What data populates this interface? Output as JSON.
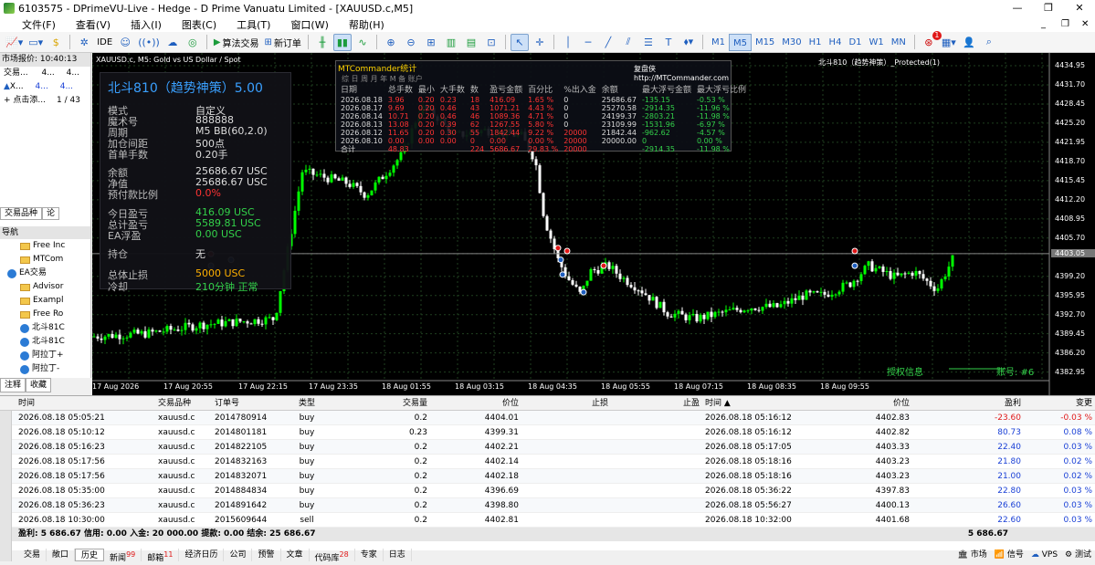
{
  "window": {
    "title": "6103575 - DPrimeVU-Live - Hedge - D Prime Vanuatu Limited - [XAUUSD.c,M5]",
    "minimize": "—",
    "restore": "❐",
    "close": "✕"
  },
  "menu": [
    "文件(F)",
    "查看(V)",
    "插入(I)",
    "图表(C)",
    "工具(T)",
    "窗口(W)",
    "帮助(H)"
  ],
  "toolbar": {
    "algo": "算法交易",
    "neworder": "新订单",
    "ide": "IDE",
    "timeframes": [
      "M1",
      "M5",
      "M15",
      "M30",
      "H1",
      "H4",
      "D1",
      "W1",
      "MN"
    ],
    "active_tf": "M5",
    "badge": "1"
  },
  "market_watch": {
    "header": "市场报价: 10:40:13",
    "col1": "交易...",
    "col2": "4...",
    "col3": "4...",
    "sym": "X...",
    "v1": "4...",
    "v2": "4...",
    "add": "+ 点击添...",
    "count": "1 / 43"
  },
  "mw_tabs": [
    "交易品种",
    "论"
  ],
  "navigator": {
    "header": "导航",
    "items": [
      {
        "t": "Free Inc",
        "k": "folder"
      },
      {
        "t": "MTCom",
        "k": "folder"
      },
      {
        "t": "EA交易",
        "k": "ea"
      },
      {
        "t": "Advisor",
        "k": "folder"
      },
      {
        "t": "Exampl",
        "k": "folder"
      },
      {
        "t": "Free Ro",
        "k": "folder"
      },
      {
        "t": "北斗81C",
        "k": "ea"
      },
      {
        "t": "北斗81C",
        "k": "ea"
      },
      {
        "t": "阿拉丁+",
        "k": "ea"
      },
      {
        "t": "阿拉丁-",
        "k": "ea"
      }
    ]
  },
  "nav_tabs": [
    "注释",
    "收藏"
  ],
  "chart": {
    "symbol_line": "XAUUSD.c, M5:  Gold vs US Dollar / Spot",
    "right_label": "北斗810（趋势神策）_Protected(1)",
    "auth": "授权信息",
    "account": "账号: #6",
    "current_price": "4403.05",
    "prices": [
      "4434.95",
      "4431.70",
      "4428.45",
      "4425.20",
      "4421.95",
      "4418.70",
      "4415.45",
      "4412.20",
      "4408.95",
      "4405.70",
      "4403.05",
      "4399.20",
      "4395.95",
      "4392.70",
      "4389.45",
      "4386.20",
      "4382.95"
    ],
    "times": [
      "17 Aug 2026",
      "17 Aug 20:55",
      "17 Aug 22:15",
      "17 Aug 23:35",
      "18 Aug 01:55",
      "18 Aug 03:15",
      "18 Aug 04:35",
      "18 Aug 05:55",
      "18 Aug 07:15",
      "18 Aug 08:35",
      "18 Aug 09:55"
    ]
  },
  "ea_panel": {
    "title": "北斗810（趋势神策）5.00",
    "rows": [
      {
        "k": "模式",
        "v": "自定义",
        "c": ""
      },
      {
        "k": "魔术号",
        "v": "888888",
        "c": ""
      },
      {
        "k": "周期",
        "v": "M5  BB(60,2.0)",
        "c": ""
      },
      {
        "k": "加仓间距",
        "v": "500点",
        "c": ""
      },
      {
        "k": "首单手数",
        "v": "0.20手",
        "c": ""
      },
      {
        "k": "余额",
        "v": "25686.67 USC",
        "c": ""
      },
      {
        "k": "净值",
        "v": "25686.67 USC",
        "c": ""
      },
      {
        "k": "预付款比例",
        "v": "0.0%",
        "c": "red"
      },
      {
        "k": "今日盈亏",
        "v": "416.09 USC",
        "c": "green"
      },
      {
        "k": "总计盈亏",
        "v": "5589.81 USC",
        "c": "green"
      },
      {
        "k": "EA浮盈",
        "v": "0.00 USC",
        "c": "green"
      },
      {
        "k": "持仓",
        "v": "无",
        "c": ""
      },
      {
        "k": "总体止损",
        "v": "5000 USC",
        "c": "orange"
      },
      {
        "k": "冷却",
        "v": "210分钟  正常",
        "c": "green"
      }
    ]
  },
  "stats": {
    "title": "MTCommander统计",
    "review": "复盘侠  http://MTCommander.com",
    "tabs": "综  日  周  月  年  M  备  账户",
    "headers": [
      "日期",
      "总手数",
      "最小",
      "大手数",
      "数",
      "盈亏金额",
      "百分比",
      "%出入金",
      "余额",
      "最大浮亏金额",
      "最大浮亏比例"
    ],
    "rows": [
      [
        "2026.08.18",
        "3.96",
        "0.20",
        "0.23",
        "18",
        "416.09",
        "1.65 %",
        "0",
        "25686.67",
        "-135.15",
        "-0.53 %"
      ],
      [
        "2026.08.17",
        "9.69",
        "0.20",
        "0.46",
        "43",
        "1071.21",
        "4.43 %",
        "0",
        "25270.58",
        "-2914.35",
        "-11.96 %"
      ],
      [
        "2026.08.14",
        "10.71",
        "0.20",
        "0.46",
        "46",
        "1089.36",
        "4.71 %",
        "0",
        "24199.37",
        "-2803.21",
        "-11.98 %"
      ],
      [
        "2026.08.13",
        "13.08",
        "0.20",
        "0.39",
        "62",
        "1267.55",
        "5.80 %",
        "0",
        "23109.99",
        "-1531.96",
        "-6.97 %"
      ],
      [
        "2026.08.12",
        "11.65",
        "0.20",
        "0.30",
        "55",
        "1842.44",
        "9.22 %",
        "20000",
        "21842.44",
        "-962.62",
        "-4.57 %"
      ],
      [
        "2026.08.10",
        "0.00",
        "0.00",
        "0.00",
        "0",
        "0.00",
        "0.00 %",
        "20000",
        "20000.00",
        "0",
        "0.00 %"
      ],
      [
        "合计",
        "48.83",
        "",
        "",
        "224",
        "5686.67",
        "29.83 %",
        "20000",
        "",
        "-2914.35",
        "-11.98 %"
      ]
    ]
  },
  "history": {
    "headers": [
      "时间",
      "交易品种",
      "订单号",
      "类型",
      "交易量",
      "价位",
      "止损",
      "止盈",
      "时间 ▲",
      "价位",
      "盈利",
      "变更"
    ],
    "rows": [
      [
        "2026.08.18 05:05:21",
        "xauusd.c",
        "2014780914",
        "buy",
        "0.2",
        "4404.01",
        "",
        "",
        "2026.08.18 05:16:12",
        "4402.83",
        "-23.60",
        "-0.03 %"
      ],
      [
        "2026.08.18 05:10:12",
        "xauusd.c",
        "2014801181",
        "buy",
        "0.23",
        "4399.31",
        "",
        "",
        "2026.08.18 05:16:12",
        "4402.82",
        "80.73",
        "0.08 %"
      ],
      [
        "2026.08.18 05:16:23",
        "xauusd.c",
        "2014822105",
        "buy",
        "0.2",
        "4402.21",
        "",
        "",
        "2026.08.18 05:17:05",
        "4403.33",
        "22.40",
        "0.03 %"
      ],
      [
        "2026.08.18 05:17:56",
        "xauusd.c",
        "2014832163",
        "buy",
        "0.2",
        "4402.14",
        "",
        "",
        "2026.08.18 05:18:16",
        "4403.23",
        "21.80",
        "0.02 %"
      ],
      [
        "2026.08.18 05:17:56",
        "xauusd.c",
        "2014832071",
        "buy",
        "0.2",
        "4402.18",
        "",
        "",
        "2026.08.18 05:18:16",
        "4403.23",
        "21.00",
        "0.02 %"
      ],
      [
        "2026.08.18 05:35:00",
        "xauusd.c",
        "2014884834",
        "buy",
        "0.2",
        "4396.69",
        "",
        "",
        "2026.08.18 05:36:22",
        "4397.83",
        "22.80",
        "0.03 %"
      ],
      [
        "2026.08.18 05:36:23",
        "xauusd.c",
        "2014891642",
        "buy",
        "0.2",
        "4398.80",
        "",
        "",
        "2026.08.18 05:56:27",
        "4400.13",
        "26.60",
        "0.03 %"
      ],
      [
        "2026.08.18 10:30:00",
        "xauusd.c",
        "2015609644",
        "sell",
        "0.2",
        "4402.81",
        "",
        "",
        "2026.08.18 10:32:00",
        "4401.68",
        "22.60",
        "0.03 %"
      ]
    ],
    "summary": "盈利: 5 686.67  信用: 0.00  入金: 20 000.00  提款: 0.00  结余: 25 686.67",
    "summary_total": "5 686.67"
  },
  "bottom_tabs": [
    {
      "t": "交易",
      "b": ""
    },
    {
      "t": "敞口",
      "b": ""
    },
    {
      "t": "历史",
      "b": ""
    },
    {
      "t": "新闻",
      "b": "99"
    },
    {
      "t": "邮箱",
      "b": "11"
    },
    {
      "t": "经济日历",
      "b": ""
    },
    {
      "t": "公司",
      "b": ""
    },
    {
      "t": "预警",
      "b": ""
    },
    {
      "t": "文章",
      "b": ""
    },
    {
      "t": "代码库",
      "b": "28"
    },
    {
      "t": "专家",
      "b": ""
    },
    {
      "t": "日志",
      "b": ""
    }
  ],
  "active_bottom_tab": "历史",
  "status": [
    "市场",
    "信号",
    "VPS",
    "测试"
  ],
  "colors": {
    "bull": "#00ff00",
    "bear": "#ffffff",
    "bg": "#000000",
    "grid": "#1f3f1f",
    "price_line": "#888888"
  }
}
